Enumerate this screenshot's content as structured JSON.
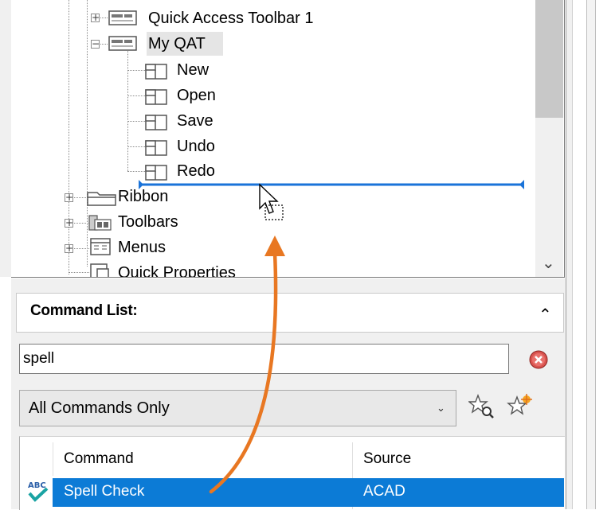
{
  "tree": {
    "items": [
      {
        "label": "Quick Access Toolbar 1",
        "expander": "+"
      },
      {
        "label": "My QAT",
        "expander": "−"
      },
      {
        "label": "New"
      },
      {
        "label": "Open"
      },
      {
        "label": "Save"
      },
      {
        "label": "Undo"
      },
      {
        "label": "Redo"
      },
      {
        "label": "Ribbon",
        "expander": "+"
      },
      {
        "label": "Toolbars",
        "expander": "+"
      },
      {
        "label": "Menus",
        "expander": "+"
      },
      {
        "label": "Quick Properties"
      }
    ],
    "scroll_down_glyph": "⌄"
  },
  "command_list": {
    "title": "Command List:",
    "collapse_glyph": "⌃",
    "search_value": "spell",
    "filter_selected": "All Commands Only",
    "filter_chevron": "⌄",
    "columns": {
      "command": "Command",
      "source": "Source"
    },
    "rows": [
      {
        "command": "Spell Check",
        "source": "ACAD",
        "selected": true
      }
    ]
  },
  "colors": {
    "selection": "#0c7bd6",
    "drop_indicator": "#1a73d9",
    "drag_arrow": "#e87722"
  }
}
